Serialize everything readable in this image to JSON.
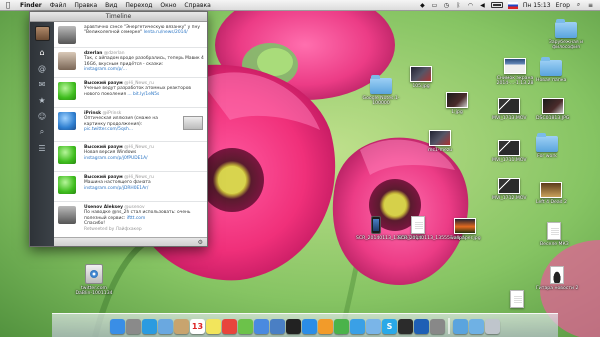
{
  "menubar": {
    "apple": "",
    "items": [
      "Finder",
      "Файл",
      "Правка",
      "Вид",
      "Переход",
      "Окно",
      "Справка"
    ],
    "clock": "Пн 15:13",
    "user": "Егор"
  },
  "twitter": {
    "title": "Timeline",
    "tweets": [
      {
        "name": "",
        "handle": "",
        "text": "аравтично сэнсе \"Энергетическую вязанку\" у пну \"Великолепной семерке\"",
        "link": "lenta.ru/news/2014/",
        "avatar": "mono"
      },
      {
        "name": "dzerlan",
        "handle": "@dzerlan",
        "text": "Так, с айпадом вроде разобрались, теперь Мавик 4 16Gб, вкусным придётся - сказки:",
        "link": "instagram.com/p/...",
        "avatar": "photo"
      },
      {
        "name": "Высокий разум",
        "handle": "@Hi_News_ru",
        "text": "Ученые ведут разработок атомных реакторов нового поколения",
        "link": "... bit.ly/1eN5s",
        "avatar": "green"
      },
      {
        "name": "iPrinsk",
        "handle": "@iPrinsk",
        "text": "Оптическая иллюзия (смаже на картинку продолжения):",
        "link": "pic.twitter.com/5qsh...",
        "avatar": "blue"
      },
      {
        "name": "Высокий разум",
        "handle": "@Hi_News_ru",
        "text": "Новая версия Windows",
        "link": "instagram.com/p/j0fPUDE1A/",
        "avatar": "green"
      },
      {
        "name": "Высокий разум",
        "handle": "@Hi_News_ru",
        "text": "Машина настоящего фаната",
        "link": "instagram.com/p/jDRH0E1Ar/",
        "avatar": "green"
      },
      {
        "name": "Usenov Aleksey",
        "handle": "@usenov",
        "text": "По наводке @ns_2h стал использовать: очень полезный сервис:",
        "link": "ifttt.com",
        "extra": "Спасибо!",
        "retweet": "Retweeted by Лайфхакер",
        "avatar": "mono"
      }
    ]
  },
  "desktop": {
    "icons": [
      {
        "label": "Зарубежная и философия",
        "kind": "folder"
      },
      {
        "label": "Новая папка",
        "kind": "folder"
      },
      {
        "label": "Снимок экрана 2014-...-1.13.28",
        "kind": "screen1"
      },
      {
        "label": "Google Notes.1-100000",
        "kind": "folder"
      },
      {
        "label": "105.jpg",
        "kind": "dark"
      },
      {
        "label": "1.jpg",
        "kind": "dark2"
      },
      {
        "label": "MVI_1713.MOV",
        "kind": "movie"
      },
      {
        "label": "DSC01813.JPG",
        "kind": "dark2"
      },
      {
        "label": "mc1-mezu",
        "kind": "dark"
      },
      {
        "label": "For work",
        "kind": "folder"
      },
      {
        "label": "MVI_1711.MOV",
        "kind": "movie"
      },
      {
        "label": "MVI_1712.MOV",
        "kind": "movie"
      },
      {
        "label": "Left 4 Dead 2",
        "kind": "game"
      },
      {
        "label": "SCR_20140113_135557.mp4",
        "kind": "phone"
      },
      {
        "label": "SCR_20140113_135557.mp4",
        "kind": "doc"
      },
      {
        "label": "wallpaper.jpg",
        "kind": "sunset"
      },
      {
        "label": "Веселе МКЗ",
        "kind": "doc"
      },
      {
        "label": "twitter.com DaBlin-1001134",
        "kind": "disk"
      },
      {
        "label": "Гитара новости 2",
        "kind": "guitar"
      }
    ]
  },
  "dock": {
    "items": [
      {
        "name": "finder",
        "color": "#3a8ee6"
      },
      {
        "name": "launchpad",
        "color": "#8a8a8a"
      },
      {
        "name": "safari",
        "color": "#2b9be0"
      },
      {
        "name": "mail",
        "color": "#6aa8e0"
      },
      {
        "name": "contacts",
        "color": "#c8a46e"
      },
      {
        "name": "calendar",
        "color": "#ffffff",
        "text": "13"
      },
      {
        "name": "notes",
        "color": "#f2e55c"
      },
      {
        "name": "chrome",
        "color": "#e8453c"
      },
      {
        "name": "photos",
        "color": "#6cc24a"
      },
      {
        "name": "itunes",
        "color": "#4a8ae0"
      },
      {
        "name": "xcode",
        "color": "#4a7fc4"
      },
      {
        "name": "dvd",
        "color": "#222222"
      },
      {
        "name": "appstore",
        "color": "#2b8de6"
      },
      {
        "name": "ibooks",
        "color": "#f29b2a"
      },
      {
        "name": "facetime",
        "color": "#4ab34a"
      },
      {
        "name": "twitter",
        "color": "#3aa0e6"
      },
      {
        "name": "preview",
        "color": "#7ab5e8"
      },
      {
        "name": "skype",
        "color": "#2aa9e8",
        "text": "S"
      },
      {
        "name": "terminal",
        "color": "#2b2b2b"
      },
      {
        "name": "quicktime",
        "color": "#1e5fb5"
      },
      {
        "name": "sysprefs",
        "color": "#888888"
      },
      {
        "name": "downloads",
        "color": "#5aa4de"
      },
      {
        "name": "documents",
        "color": "#6fb1e4"
      },
      {
        "name": "trash",
        "color": "#bfc5cc"
      }
    ]
  }
}
